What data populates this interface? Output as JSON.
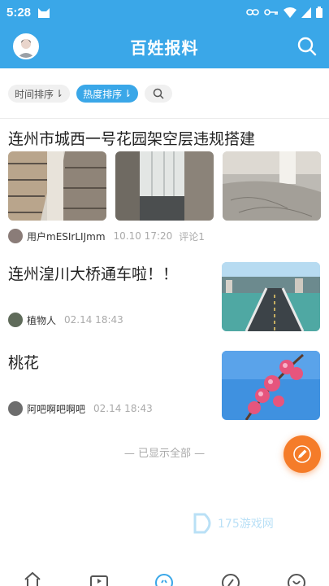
{
  "status_bar": {
    "time": "5:28"
  },
  "header": {
    "title": "百姓报料"
  },
  "filters": {
    "time_sort": "时间排序",
    "hot_sort": "热度排序"
  },
  "posts": [
    {
      "title": "连州市城西一号花园架空层违规搭建",
      "user": "用户mESIrLIJmm",
      "time": "10.10 17:20",
      "comments": "评论1"
    },
    {
      "title": "连州湟川大桥通车啦！！",
      "user": "植物人",
      "time": "02.14 18:43"
    },
    {
      "title": "桃花",
      "user": "阿吧啊吧啊吧",
      "time": "02.14 18:43"
    }
  ],
  "footer": {
    "end_text": "— 已显示全部 —"
  },
  "watermark": "175游戏网",
  "colors": {
    "brand": "#3aa7e8",
    "fab": "#f57c29"
  }
}
